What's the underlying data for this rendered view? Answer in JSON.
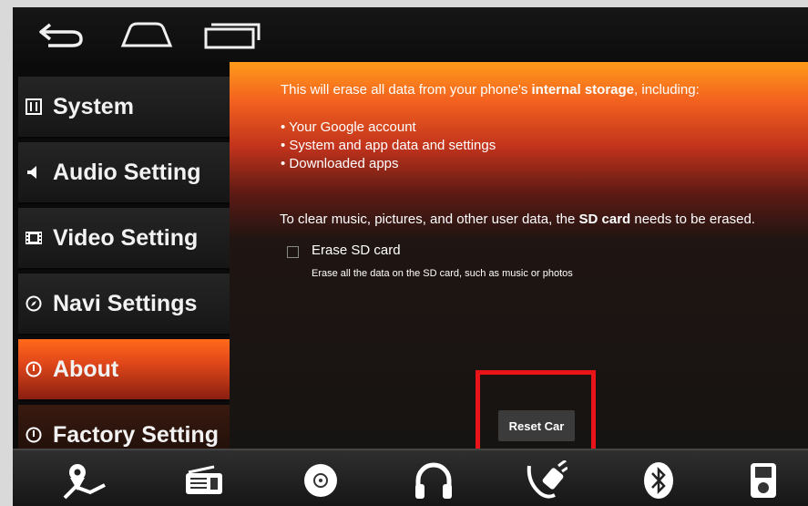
{
  "nav": {
    "back_icon": "back-arrow-icon",
    "home_icon": "home-icon",
    "recents_icon": "recent-apps-icon"
  },
  "sidebar": {
    "items": [
      {
        "label": "System",
        "icon": "system-icon"
      },
      {
        "label": "Audio Setting",
        "icon": "speaker-icon"
      },
      {
        "label": "Video Setting",
        "icon": "film-icon"
      },
      {
        "label": "Navi Settings",
        "icon": "compass-icon"
      },
      {
        "label": "About",
        "icon": "info-icon"
      },
      {
        "label": "Factory Setting",
        "icon": "info-icon"
      }
    ],
    "active": "About"
  },
  "content": {
    "intro_pre": "This will erase all data from your phone's ",
    "intro_bold": "internal storage",
    "intro_post": ", including:",
    "bullets": [
      "Your Google account",
      "System and app data and settings",
      "Downloaded apps"
    ],
    "sd_pre": "To clear music, pictures, and other user data, the ",
    "sd_bold": "SD card",
    "sd_post": " needs to be erased.",
    "erase_title": "Erase SD card",
    "erase_sub": "Erase all the data on the SD card, such as music or photos",
    "erase_checked": false,
    "reset_label": "Reset Car"
  },
  "dock": {
    "icons": [
      "navigation-icon",
      "radio-icon",
      "disc-icon",
      "headphones-icon",
      "phone-link-icon",
      "bluetooth-icon",
      "media-player-icon"
    ]
  },
  "colors": {
    "accent_orange": "#f3621f",
    "highlight_red": "#e8141a"
  }
}
